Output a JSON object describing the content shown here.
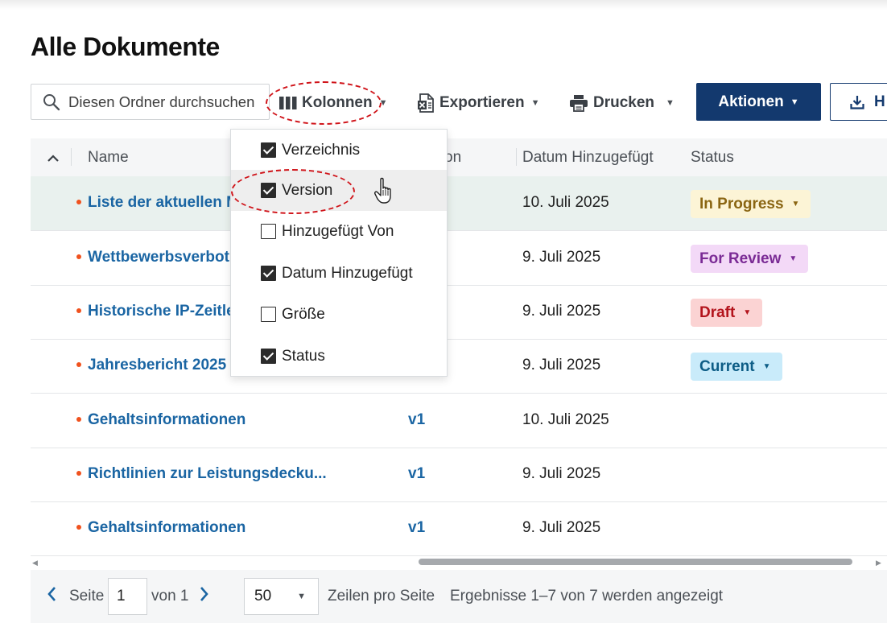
{
  "page_title": "Alle Dokumente",
  "search": {
    "placeholder": "Diesen Ordner durchsuchen"
  },
  "toolbar": {
    "columns_label": "Kolonnen",
    "export_label": "Exportieren",
    "print_label": "Drucken",
    "actions_label": "Aktionen",
    "upload_label": "H"
  },
  "table": {
    "headers": {
      "name": "Name",
      "version_partial": "on",
      "date_added": "Datum Hinzugefügt",
      "status": "Status"
    },
    "rows": [
      {
        "name": "Liste der aktuellen M",
        "version": "",
        "date": "10. Juli 2025",
        "status": "In Progress",
        "selected": true
      },
      {
        "name": "Wettbewerbsverbot",
        "version": "",
        "date": "9. Juli 2025",
        "status": "For Review"
      },
      {
        "name": "Historische IP-Zeitle",
        "version": "",
        "date": "9. Juli 2025",
        "status": "Draft"
      },
      {
        "name": "Jahresbericht 2025",
        "version": "",
        "date": "9. Juli 2025",
        "status": "Current"
      },
      {
        "name": "Gehaltsinformationen",
        "version": "v1",
        "date": "10. Juli 2025",
        "status": ""
      },
      {
        "name": "Richtlinien zur Leistungsdecku...",
        "version": "v1",
        "date": "9. Juli 2025",
        "status": ""
      },
      {
        "name": "Gehaltsinformationen",
        "version": "v1",
        "date": "9. Juli 2025",
        "status": ""
      }
    ]
  },
  "status_colors": {
    "In Progress": {
      "bg": "#fcf4d6",
      "fg": "#8a6512"
    },
    "For Review": {
      "bg": "#f3d9f7",
      "fg": "#7a2a95"
    },
    "Draft": {
      "bg": "#fbd3d3",
      "fg": "#b3141c"
    },
    "Current": {
      "bg": "#c9ebfa",
      "fg": "#0d5d86"
    }
  },
  "column_menu": {
    "items": [
      {
        "label": "Verzeichnis",
        "checked": true
      },
      {
        "label": "Version",
        "checked": true,
        "hovered": true
      },
      {
        "label": "Hinzugefügt Von",
        "checked": false
      },
      {
        "label": "Datum Hinzugefügt",
        "checked": true
      },
      {
        "label": "Größe",
        "checked": false
      },
      {
        "label": "Status",
        "checked": true
      }
    ]
  },
  "pagination": {
    "page_label": "Seite",
    "page_value": "1",
    "of_label": "von 1",
    "per_page_value": "50",
    "per_page_label": "Zeilen pro Seite",
    "results_text": "Ergebnisse 1–7 von 7 werden angezeigt"
  },
  "colors": {
    "accent": "#13396e",
    "link": "#1a65a3",
    "dot": "#f0521e",
    "annotation": "#d0141a"
  }
}
